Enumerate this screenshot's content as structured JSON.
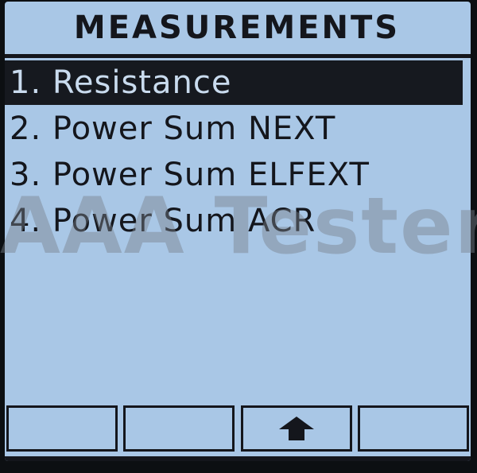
{
  "title": "MEASUREMENTS",
  "menu": {
    "items": [
      {
        "label": "1. Resistance",
        "selected": true
      },
      {
        "label": "2. Power Sum NEXT",
        "selected": false
      },
      {
        "label": "3. Power Sum ELFEXT",
        "selected": false
      },
      {
        "label": "4. Power Sum ACR",
        "selected": false
      }
    ]
  },
  "softkeys": [
    {
      "label": "",
      "icon": null
    },
    {
      "label": "",
      "icon": null
    },
    {
      "label": "",
      "icon": "arrow-up-icon"
    },
    {
      "label": "",
      "icon": null
    }
  ],
  "watermark": "AAA Testers",
  "colors": {
    "screen_background": "#a9c7e6",
    "text": "#14161c",
    "selection_background": "#16191f",
    "selection_text": "#c9dbee",
    "bezel": "#0c0f12"
  }
}
